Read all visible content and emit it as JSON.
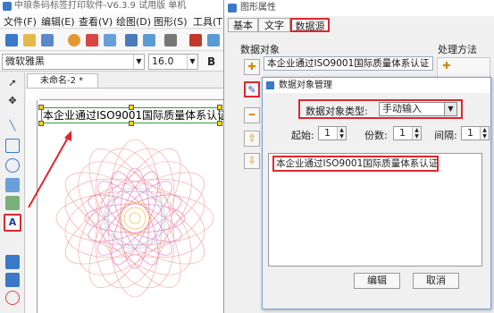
{
  "app": {
    "title": "中琅条码标签打印软件-V6.3.9 试用版 单机",
    "menu": [
      "文件(F)",
      "编辑(E)",
      "查看(V)",
      "绘图(D)",
      "图形(S)",
      "工具(T)"
    ],
    "font_name": "微软雅黑",
    "font_size": "16.0",
    "bold_label": "B",
    "document_tab": "未命名-2 *",
    "label_text": "本企业通过ISO9001国际质量体系认证",
    "text_tool_glyph": "A"
  },
  "properties": {
    "title": "图形属性",
    "tabs": [
      "基本",
      "文字",
      "数据源"
    ],
    "active_tab": "数据源",
    "data_object_label": "数据对象",
    "handle_method_label": "处理方法",
    "data_object_value": "本企业通过ISO9001国际质量体系认证"
  },
  "dialog": {
    "title": "数据对象管理",
    "type_label": "数据对象类型:",
    "type_value": "手动输入",
    "start_label": "起始:",
    "start_value": "1",
    "count_label": "份数:",
    "count_value": "1",
    "interval_label": "间隔:",
    "interval_value": "1",
    "content": "本企业通过ISO9001国际质量体系认证",
    "edit_button": "编辑",
    "cancel_button": "取消"
  },
  "colors": {
    "highlight": "#e0262c",
    "selection": "#3b9d3b",
    "accent": "#3a78c8"
  },
  "icons": [
    "app-logo-icon",
    "add-icon",
    "edit-icon",
    "minus-icon",
    "up-arrow-icon",
    "down-arrow-icon",
    "flower-guilloche-graphic"
  ]
}
